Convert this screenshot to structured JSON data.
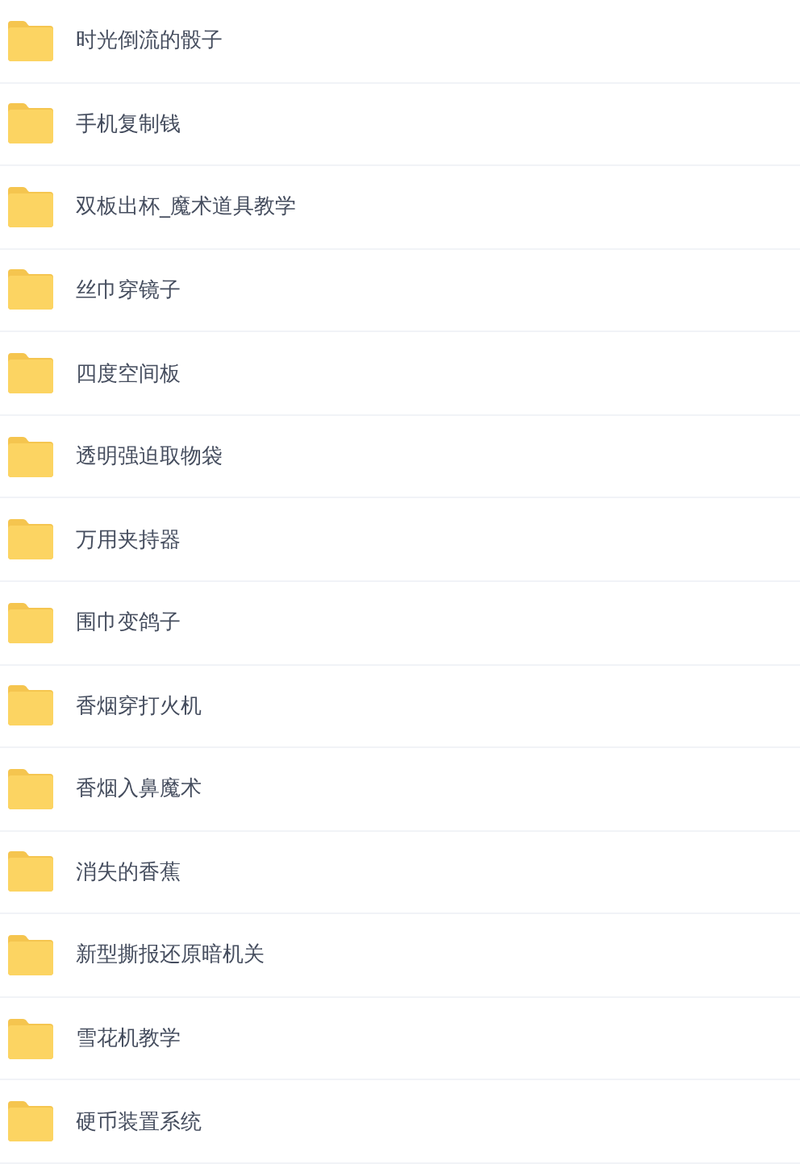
{
  "folders": [
    {
      "name": "时光倒流的骰子"
    },
    {
      "name": "手机复制钱"
    },
    {
      "name": "双板出杯_魔术道具教学"
    },
    {
      "name": "丝巾穿镜子"
    },
    {
      "name": "四度空间板"
    },
    {
      "name": "透明强迫取物袋"
    },
    {
      "name": "万用夹持器"
    },
    {
      "name": "围巾变鸽子"
    },
    {
      "name": "香烟穿打火机"
    },
    {
      "name": "香烟入鼻魔术"
    },
    {
      "name": "消失的香蕉"
    },
    {
      "name": "新型撕报还原暗机关"
    },
    {
      "name": "雪花机教学"
    },
    {
      "name": "硬币装置系统"
    }
  ]
}
